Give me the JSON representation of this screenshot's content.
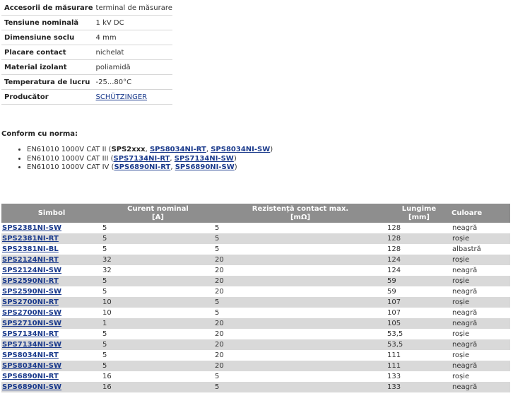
{
  "specs": [
    {
      "label": "Accesorii de măsurare",
      "value": "terminal de măsurare",
      "link": false
    },
    {
      "label": "Tensiune nominală",
      "value": "1 kV DC",
      "link": false
    },
    {
      "label": "Dimensiune soclu",
      "value": "4 mm",
      "link": false
    },
    {
      "label": "Placare contact",
      "value": "nichelat",
      "link": false
    },
    {
      "label": "Material izolant",
      "value": "poliamidă",
      "link": false
    },
    {
      "label": "Temperatura de lucru",
      "value": "-25...80°C",
      "link": false
    },
    {
      "label": "Producător",
      "value": "SCHÜTZINGER",
      "link": true
    }
  ],
  "norms": {
    "title": "Conform cu norma:",
    "items": [
      {
        "prefix": "EN61010 1000V CAT II (",
        "parts": [
          {
            "text": "SPS2xxx",
            "link": false
          },
          {
            "text": ", ",
            "sep": true
          },
          {
            "text": "SPS8034NI-RT",
            "link": true
          },
          {
            "text": ", ",
            "sep": true
          },
          {
            "text": "SPS8034NI-SW",
            "link": true
          }
        ],
        "suffix": ")"
      },
      {
        "prefix": "EN61010 1000V CAT III (",
        "parts": [
          {
            "text": "SPS7134NI-RT",
            "link": true
          },
          {
            "text": ", ",
            "sep": true
          },
          {
            "text": "SPS7134NI-SW",
            "link": true
          }
        ],
        "suffix": ")"
      },
      {
        "prefix": "EN61010 1000V CAT IV (",
        "parts": [
          {
            "text": "SPS6890NI-RT",
            "link": true
          },
          {
            "text": ", ",
            "sep": true
          },
          {
            "text": "SPS6890NI-SW",
            "link": true
          }
        ],
        "suffix": ")"
      }
    ]
  },
  "table": {
    "headers": [
      {
        "line1": "Simbol",
        "line2": ""
      },
      {
        "line1": "Curent nominal",
        "line2": "[A]"
      },
      {
        "line1": "Rezistență contact max.",
        "line2": "[mΩ]"
      },
      {
        "line1": "Lungime",
        "line2": "[mm]"
      },
      {
        "line1": "Culoare",
        "line2": ""
      }
    ],
    "rows": [
      [
        "SPS2381NI-SW",
        "5",
        "5",
        "128",
        "neagră"
      ],
      [
        "SPS2381NI-RT",
        "5",
        "5",
        "128",
        "roșie"
      ],
      [
        "SPS2381NI-BL",
        "5",
        "5",
        "128",
        "albastră"
      ],
      [
        "SPS2124NI-RT",
        "32",
        "20",
        "124",
        "roșie"
      ],
      [
        "SPS2124NI-SW",
        "32",
        "20",
        "124",
        "neagră"
      ],
      [
        "SPS2590NI-RT",
        "5",
        "20",
        "59",
        "roșie"
      ],
      [
        "SPS2590NI-SW",
        "5",
        "20",
        "59",
        "neagră"
      ],
      [
        "SPS2700NI-RT",
        "10",
        "5",
        "107",
        "roșie"
      ],
      [
        "SPS2700NI-SW",
        "10",
        "5",
        "107",
        "neagră"
      ],
      [
        "SPS2710NI-SW",
        "1",
        "20",
        "105",
        "neagră"
      ],
      [
        "SPS7134NI-RT",
        "5",
        "20",
        "53,5",
        "roșie"
      ],
      [
        "SPS7134NI-SW",
        "5",
        "20",
        "53,5",
        "neagră"
      ],
      [
        "SPS8034NI-RT",
        "5",
        "20",
        "111",
        "roșie"
      ],
      [
        "SPS8034NI-SW",
        "5",
        "20",
        "111",
        "neagră"
      ],
      [
        "SPS6890NI-RT",
        "16",
        "5",
        "133",
        "roșie"
      ],
      [
        "SPS6890NI-SW",
        "16",
        "5",
        "133",
        "neagră"
      ]
    ]
  },
  "colors": {
    "header_bg": "#8e8e8e",
    "alt_row": "#d9d9d9",
    "link": "#1a3a8c"
  }
}
